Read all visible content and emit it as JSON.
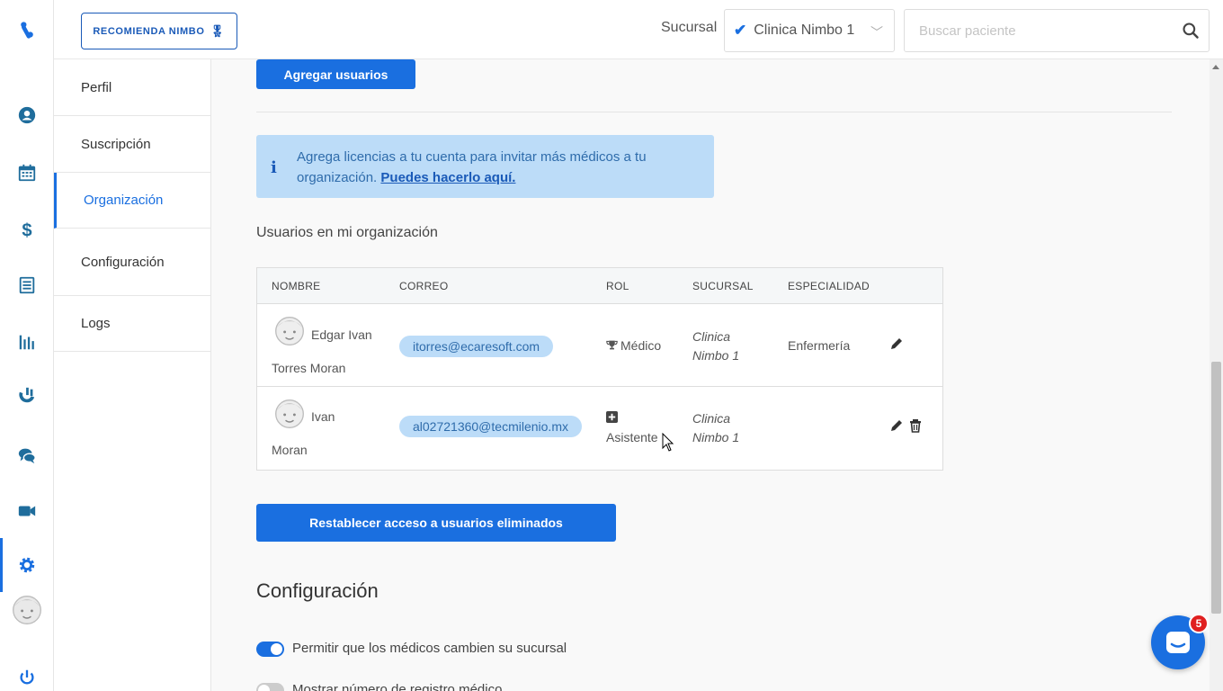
{
  "topbar": {
    "recommend_label": "RECOMIENDA NIMBO",
    "sucursal_label": "Sucursal",
    "sucursal_value": "Clinica Nimbo 1",
    "search_placeholder": "Buscar paciente"
  },
  "rail": {
    "icons": [
      "logo-icon",
      "user-icon",
      "calendar-icon",
      "dollar-icon",
      "list-icon",
      "chart-icon",
      "magnet-icon",
      "chat-icon",
      "video-icon",
      "gear-icon",
      "avatar",
      "power-icon"
    ],
    "active": "gear-icon",
    "accent": "#1a6fe0"
  },
  "subnav": {
    "items": [
      "Perfil",
      "Suscripción",
      "Organización",
      "Configuración",
      "Logs"
    ],
    "active": "Organización"
  },
  "main": {
    "add_users_label": "Agregar usuarios",
    "info": {
      "text": "Agrega licencias a tu cuenta para invitar más médicos a tu organización.",
      "link": "Puedes hacerlo aquí."
    },
    "users_title": "Usuarios en mi organización",
    "table": {
      "headers": [
        "NOMBRE",
        "CORREO",
        "ROL",
        "SUCURSAL",
        "ESPECIALIDAD"
      ],
      "rows": [
        {
          "first": "Edgar Ivan",
          "last": "Torres Moran",
          "email": "itorres@ecaresoft.com",
          "role": "Médico",
          "sucursal_1": "Clinica",
          "sucursal_2": "Nimbo 1",
          "especialidad": "Enfermería"
        },
        {
          "first": "Ivan",
          "last": "Moran",
          "email": "al02721360@tecmilenio.mx",
          "role": "Asistente",
          "sucursal_1": "Clinica",
          "sucursal_2": "Nimbo 1",
          "especialidad": ""
        }
      ]
    },
    "restore_label": "Restablecer acceso a usuarios eliminados",
    "config_title": "Configuración",
    "toggles": [
      {
        "label": "Permitir que los médicos cambien su sucursal",
        "on": true
      },
      {
        "label": "Mostrar número de registro médico",
        "on": false
      }
    ]
  },
  "chat": {
    "badge": "5"
  },
  "colors": {
    "primary": "#1a6fe0",
    "info_bg": "#bcdcf8",
    "badge": "#e02020"
  }
}
